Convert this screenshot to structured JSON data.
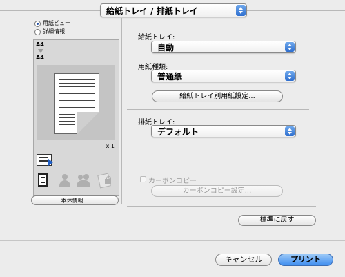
{
  "header": {
    "section_label": "給紙トレイ / 排紙トレイ"
  },
  "view_mode": {
    "options": [
      "用紙ビュー",
      "詳細情報"
    ],
    "selected_index": 0
  },
  "preview": {
    "input_size": "A4",
    "output_size": "A4",
    "copies": "x 1",
    "device_info_button": "本体情報..."
  },
  "paper_tray": {
    "label": "給紙トレイ:",
    "value": "自動"
  },
  "paper_type": {
    "label": "用紙種類:",
    "value": "普通紙"
  },
  "tray_paper_settings_button": "給紙トレイ別用紙設定...",
  "output_tray": {
    "label": "排紙トレイ:",
    "value": "デフォルト"
  },
  "carbon_copy": {
    "label": "カーボンコピー",
    "checked": false,
    "settings_button": "カーボンコピー設定..."
  },
  "restore_defaults_button": "標準に戻す",
  "footer": {
    "cancel": "キャンセル",
    "print": "プリント"
  },
  "colors": {
    "accent": "#3f8ef0",
    "background": "#ececec"
  }
}
